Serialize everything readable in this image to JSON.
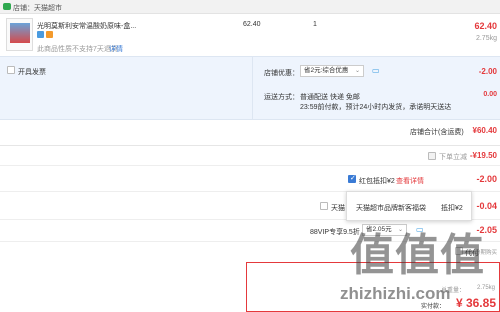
{
  "shop": {
    "label": "店铺：天猫超市"
  },
  "item": {
    "title": "光明莫斯利安常温酸奶原味-盒...",
    "note": "此商品性质不支持7天退货",
    "note_link": "详情",
    "unit_price": "62.40",
    "quantity": "1",
    "subtotal": "62.40",
    "weight": "2.75kg"
  },
  "invoice": {
    "label": "开具发票"
  },
  "store_discount": {
    "label": "店铺优惠：",
    "selected": "省2元:综合优惠",
    "amount": "-2.00"
  },
  "shipping": {
    "label": "运送方式：",
    "method": "普通配送 快递 免邮",
    "eta": "23:59前付款，预计24小时内发货，承诺明天送达",
    "price": "0.00"
  },
  "store_total": {
    "label": "店铺合计(含运费)",
    "value": "¥60.40"
  },
  "coupon_row": {
    "label": "下单立减",
    "amount": "-¥19.50"
  },
  "redpacket": {
    "label": "红包抵扣¥2",
    "link": "查看详情",
    "amount": "-2.00",
    "popup_text": "天猫超市品牌新客福袋",
    "popup_value": "抵扣¥2"
  },
  "tmall_row": {
    "label": "天猫",
    "amount": "-0.04"
  },
  "vip": {
    "label": "88VIP专享9.5折",
    "selected": "省2.05元",
    "amount": "-2.05"
  },
  "summary": {
    "pay_label": "代付",
    "weight_label": "总重量：",
    "weight": "2.75kg",
    "paid_label": "实付款：",
    "paid_value": "¥ 36.85",
    "other": "分期购买"
  },
  "watermark": {
    "site": "zhizhizhi.com",
    "glyphs": "值值值"
  },
  "colors": {
    "accent": "#e4393c",
    "blue_panel": "#eef4fd",
    "tmall": "#2fa84f"
  },
  "icons": [
    "tmall-logo-icon",
    "checkbox-icon",
    "chevron-down-icon",
    "chat-icon",
    "close-icon"
  ]
}
